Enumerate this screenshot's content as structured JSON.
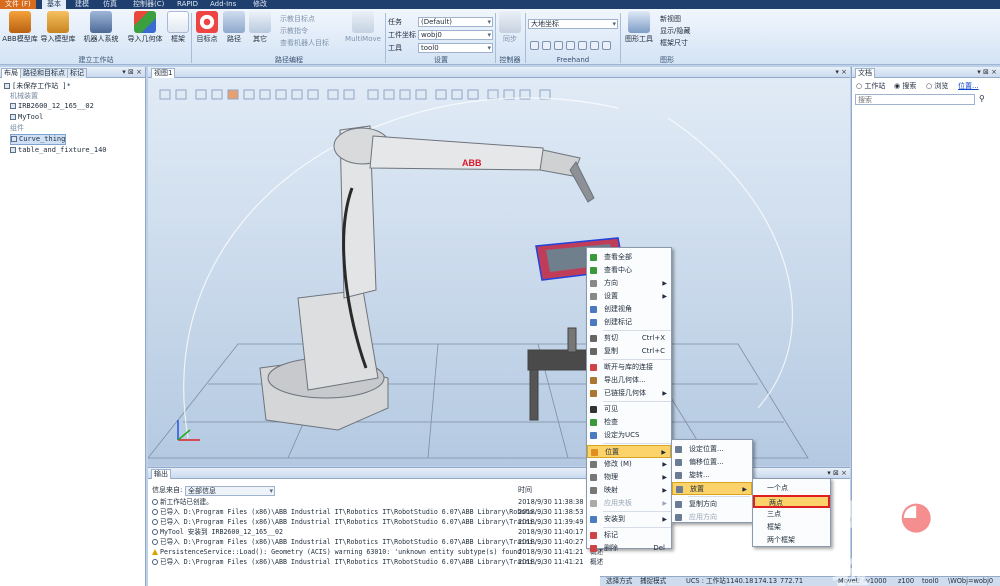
{
  "menubar": {
    "file": "文件 (F)",
    "tabs": [
      "基本",
      "建模",
      "仿真",
      "控制器(C)",
      "RAPID",
      "Add-Ins",
      "修改"
    ],
    "selected": "基本"
  },
  "ribbon": {
    "build_station": {
      "buttons": [
        "ABB模型库",
        "导入模型库",
        "机器人系统",
        "导入几何体",
        "框架"
      ],
      "label": "建立工作站"
    },
    "path_prog": {
      "buttons": [
        "目标点",
        "路径",
        "其它"
      ],
      "small": [
        "示教目标点",
        "示教指令",
        "查看机器人目标"
      ],
      "multimove": "MultiMove",
      "label": "路径编程"
    },
    "settings": {
      "task_label": "任务",
      "task_value": "(Default)",
      "wobj_label": "工件坐标",
      "wobj_value": "wobj0",
      "tool_label": "工具",
      "tool_value": "tool0",
      "label": "设置"
    },
    "controller": {
      "button": "同步",
      "label": "控制器"
    },
    "freehand": {
      "coord_value": "大地坐标",
      "label": "Freehand"
    },
    "graphics": {
      "button": "图形工具",
      "small": [
        "新视图",
        "显示/隐藏",
        "框架尺寸"
      ],
      "label": "图形"
    }
  },
  "leftpanel": {
    "tabs": [
      "布局",
      "路径和目标点",
      "标记"
    ],
    "station": "[未保存工作站 ]*",
    "mech_header": "机械装置",
    "items": [
      "IRB2600_12_165__02",
      "MyTool"
    ],
    "parts_header": "组件",
    "parts": [
      "Curve_thing",
      "table_and_fixture_140"
    ]
  },
  "viewport": {
    "tab": "视图1",
    "logo": "ABB"
  },
  "docpanel": {
    "tab": "文档",
    "radios": [
      "工作站",
      "搜索",
      "浏览"
    ],
    "radio_selected": "搜索",
    "location": "位置...",
    "search_placeholder": "搜索"
  },
  "output": {
    "tab": "输出",
    "filter_label": "信息来自:",
    "filter_value": "全部信息",
    "time_header": "时间",
    "rows": [
      {
        "text": "新工作站已创建。",
        "time": "2018/9/30 11:38:38",
        "cat": "",
        "warn": false
      },
      {
        "text": "已导入 D:\\Program Files (x86)\\ABB Industrial IT\\Robotics IT\\RobotStudio 6.07\\ABB Library\\Roboto...",
        "time": "2018/9/30 11:38:53",
        "cat": "",
        "warn": false
      },
      {
        "text": "已导入 D:\\Program Files (x86)\\ABB Industrial IT\\Robotics IT\\RobotStudio 6.07\\ABB Library\\Traini...",
        "time": "2018/9/30 11:39:49",
        "cat": "",
        "warn": false
      },
      {
        "text": "MyTool 安装到 IRB2600_12_165__02",
        "time": "2018/9/30 11:40:17",
        "cat": "",
        "warn": false
      },
      {
        "text": "已导入 D:\\Program Files (x86)\\ABB Industrial IT\\Robotics IT\\RobotStudio 6.07\\ABB Library\\Traini...",
        "time": "2018/9/30 11:40:27",
        "cat": "",
        "warn": false
      },
      {
        "text": "PersistenceService::Load(): Geometry (ACIS) warning 63010: 'unknown entity subtype(s) found'",
        "time": "2018/9/30 11:41:21",
        "cat": "概述",
        "warn": true
      },
      {
        "text": "已导入 D:\\Program Files (x86)\\ABB Industrial IT\\Robotics IT\\RobotStudio 6.07\\ABB Library\\Traini...",
        "time": "2018/9/30 11:41:21",
        "cat": "概述",
        "warn": false
      }
    ]
  },
  "status": {
    "selection": "选择方式",
    "snap": "捕捉模式",
    "ucs": "UCS : 工作站",
    "x": "1140.18",
    "y": "174.13",
    "z": "772.71",
    "move": "MoveL",
    "speed": "v1000",
    "zone": "z100",
    "tool": "tool0",
    "wobj": "\\WObj=wobj0"
  },
  "context_menu": [
    {
      "label": "查看全部",
      "shortcut": "",
      "arrow": false,
      "disabled": false,
      "sep_before": false
    },
    {
      "label": "查看中心",
      "shortcut": "",
      "arrow": false,
      "disabled": false,
      "sep_before": false
    },
    {
      "label": "方向",
      "shortcut": "",
      "arrow": true,
      "disabled": false,
      "sep_before": false
    },
    {
      "label": "设置",
      "shortcut": "",
      "arrow": true,
      "disabled": false,
      "sep_before": false
    },
    {
      "label": "创建视角",
      "shortcut": "",
      "arrow": false,
      "disabled": false,
      "sep_before": false
    },
    {
      "label": "创建标记",
      "shortcut": "",
      "arrow": false,
      "disabled": false,
      "sep_before": false
    },
    {
      "label": "剪切",
      "shortcut": "Ctrl+X",
      "arrow": false,
      "disabled": false,
      "sep_before": true
    },
    {
      "label": "复制",
      "shortcut": "Ctrl+C",
      "arrow": false,
      "disabled": false,
      "sep_before": false
    },
    {
      "label": "断开与库的连接",
      "shortcut": "",
      "arrow": false,
      "disabled": false,
      "sep_before": true
    },
    {
      "label": "导出几何体...",
      "shortcut": "",
      "arrow": false,
      "disabled": false,
      "sep_before": false
    },
    {
      "label": "已链接几何体",
      "shortcut": "",
      "arrow": true,
      "disabled": false,
      "sep_before": false
    },
    {
      "label": "可见",
      "shortcut": "",
      "arrow": false,
      "disabled": false,
      "sep_before": true
    },
    {
      "label": "检查",
      "shortcut": "",
      "arrow": false,
      "disabled": false,
      "sep_before": false
    },
    {
      "label": "设定为UCS",
      "shortcut": "",
      "arrow": false,
      "disabled": false,
      "sep_before": false
    },
    {
      "label": "位置",
      "shortcut": "",
      "arrow": true,
      "disabled": false,
      "sep_before": true
    },
    {
      "label": "修改 (M)",
      "shortcut": "",
      "arrow": true,
      "disabled": false,
      "sep_before": false
    },
    {
      "label": "物理",
      "shortcut": "",
      "arrow": true,
      "disabled": false,
      "sep_before": false
    },
    {
      "label": "映射",
      "shortcut": "",
      "arrow": true,
      "disabled": false,
      "sep_before": false
    },
    {
      "label": "应用夹板",
      "shortcut": "",
      "arrow": true,
      "disabled": true,
      "sep_before": false
    },
    {
      "label": "安装到",
      "shortcut": "",
      "arrow": true,
      "disabled": false,
      "sep_before": true
    },
    {
      "label": "标记",
      "shortcut": "",
      "arrow": false,
      "disabled": false,
      "sep_before": true
    },
    {
      "label": "删除",
      "shortcut": "Del",
      "arrow": false,
      "disabled": false,
      "sep_before": false
    }
  ],
  "position_submenu": [
    {
      "label": "设定位置...",
      "arrow": false,
      "disabled": false
    },
    {
      "label": "偏移位置...",
      "arrow": false,
      "disabled": false
    },
    {
      "label": "旋转...",
      "arrow": false,
      "disabled": false
    },
    {
      "label": "放置",
      "arrow": true,
      "disabled": false
    },
    {
      "label": "复制方向",
      "arrow": false,
      "disabled": false
    },
    {
      "label": "应用方向",
      "arrow": false,
      "disabled": true
    }
  ],
  "place_submenu": [
    "一个点",
    "两点",
    "三点",
    "框架",
    "两个框架"
  ],
  "watermark": "jingyan.baidu.com"
}
